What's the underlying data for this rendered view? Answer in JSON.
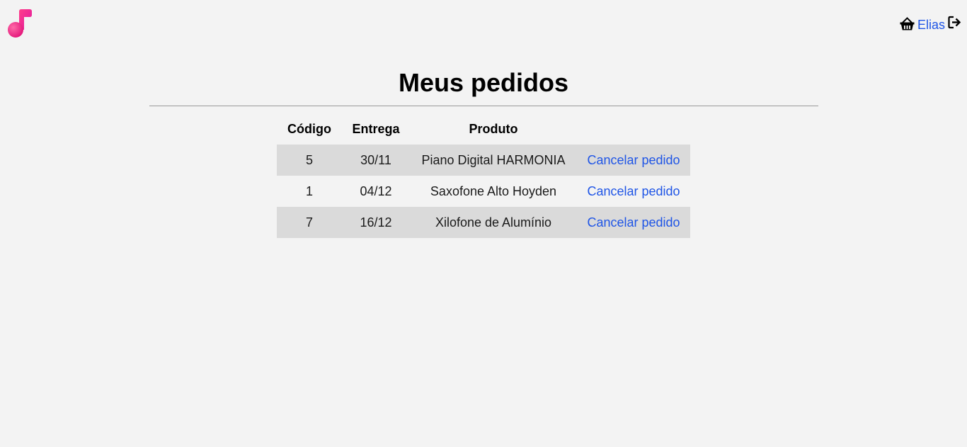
{
  "header": {
    "logo_icon": "music-note-icon",
    "cart_icon": "basket-icon",
    "user_name": "Elias",
    "logout_icon": "logout-icon"
  },
  "main": {
    "title": "Meus pedidos",
    "table": {
      "headers": [
        "Código",
        "Entrega",
        "Produto",
        ""
      ],
      "rows": [
        {
          "codigo": "5",
          "entrega": "30/11",
          "produto": "Piano Digital HARMONIA",
          "acao": "Cancelar pedido"
        },
        {
          "codigo": "1",
          "entrega": "04/12",
          "produto": "Saxofone Alto Hoyden",
          "acao": "Cancelar pedido"
        },
        {
          "codigo": "7",
          "entrega": "16/12",
          "produto": "Xilofone de Alumínio",
          "acao": "Cancelar pedido"
        }
      ]
    }
  },
  "colors": {
    "background": "#f3f3f3",
    "link": "#1f55e6",
    "row_stripe": "#dadada",
    "logo_gradient_start": "#ff2f7a",
    "logo_gradient_end": "#e21cc0"
  }
}
